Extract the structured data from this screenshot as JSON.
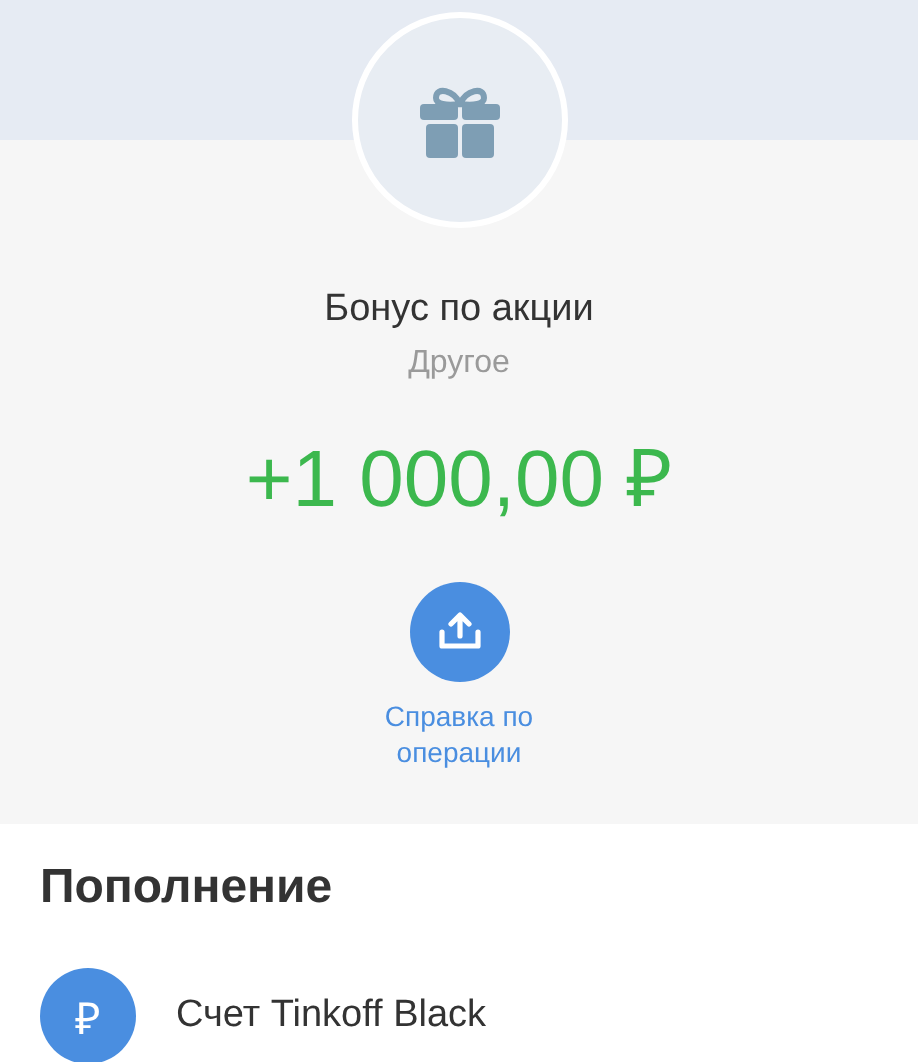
{
  "operation": {
    "title": "Бонус по акции",
    "category": "Другое",
    "amount": "+1 000,00 ₽"
  },
  "actions": [
    {
      "label": "Справка по операции"
    }
  ],
  "section": {
    "title": "Пополнение",
    "account": {
      "symbol": "₽",
      "name": "Счет Tinkoff Black"
    }
  }
}
